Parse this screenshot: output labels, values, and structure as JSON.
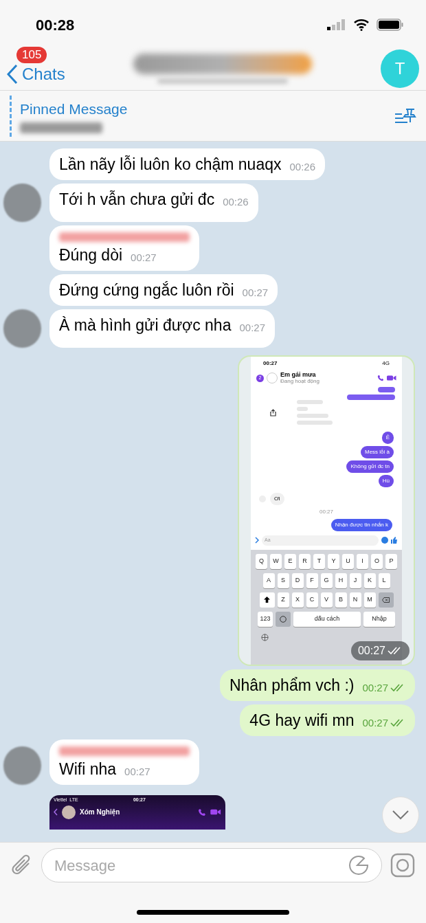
{
  "status_bar": {
    "time": "00:28"
  },
  "header": {
    "back_label": "Chats",
    "unread": "105",
    "title_hidden": true,
    "avatar_letter": "T"
  },
  "pinned": {
    "title": "Pinned Message",
    "text_hidden": true
  },
  "messages": [
    {
      "kind": "text",
      "outgoing": false,
      "avatar": false,
      "sender_hidden": false,
      "text": "Lần nãy lỗi luôn ko chậm nuaqx",
      "time": "00:26",
      "read": false
    },
    {
      "kind": "text",
      "outgoing": false,
      "avatar": true,
      "sender_hidden": false,
      "text": "Tới h vẫn chưa gửi đc",
      "time": "00:26",
      "read": false
    },
    {
      "kind": "text",
      "outgoing": false,
      "avatar": false,
      "sender_hidden": true,
      "text": "Đúng dòi",
      "time": "00:27",
      "read": false
    },
    {
      "kind": "text",
      "outgoing": false,
      "avatar": false,
      "sender_hidden": false,
      "text": "Đứng cứng ngắc luôn rồi",
      "time": "00:27",
      "read": false
    },
    {
      "kind": "text",
      "outgoing": false,
      "avatar": true,
      "sender_hidden": false,
      "text": "À mà hình gửi được nha",
      "time": "00:27",
      "read": false
    },
    {
      "kind": "screenshot",
      "outgoing": true,
      "time": "00:27",
      "read": true,
      "shot": {
        "time": "00:27",
        "network": "4G",
        "back_count": "2",
        "contact": "Em gái mưa",
        "status": "Đang hoạt động",
        "sent": [
          {
            "text": "Ê"
          },
          {
            "text": "Mess lỗi à"
          },
          {
            "text": "Không gửi đc tn"
          },
          {
            "text": "Hù"
          }
        ],
        "received": "Ơi",
        "stamp": "00:27",
        "last_sent": "Nhận được tin nhắn k",
        "placeholder": "Aa",
        "keys": [
          [
            "Q",
            "W",
            "E",
            "R",
            "T",
            "Y",
            "U",
            "I",
            "O",
            "P"
          ],
          [
            "A",
            "S",
            "D",
            "F",
            "G",
            "H",
            "J",
            "K",
            "L"
          ],
          [
            "Z",
            "X",
            "C",
            "V",
            "B",
            "N",
            "M"
          ]
        ],
        "numbers_key": "123",
        "space_key": "dấu cách",
        "return_key": "Nhập"
      }
    },
    {
      "kind": "text",
      "outgoing": true,
      "sender_hidden": false,
      "text": "Nhân phẩm vch :)",
      "time": "00:27",
      "read": true
    },
    {
      "kind": "text",
      "outgoing": true,
      "sender_hidden": false,
      "text": "4G hay wifi mn",
      "time": "00:27",
      "read": true
    },
    {
      "kind": "text",
      "outgoing": false,
      "avatar": true,
      "sender_hidden": true,
      "text": "Wifi nha",
      "time": "00:27",
      "read": false
    },
    {
      "kind": "partial_screenshot",
      "outgoing": false,
      "shot": {
        "carrier": "Viettel",
        "network": "LTE",
        "time": "00:27",
        "contact": "Xóm Nghiện"
      }
    }
  ],
  "composer": {
    "placeholder": "Message"
  }
}
